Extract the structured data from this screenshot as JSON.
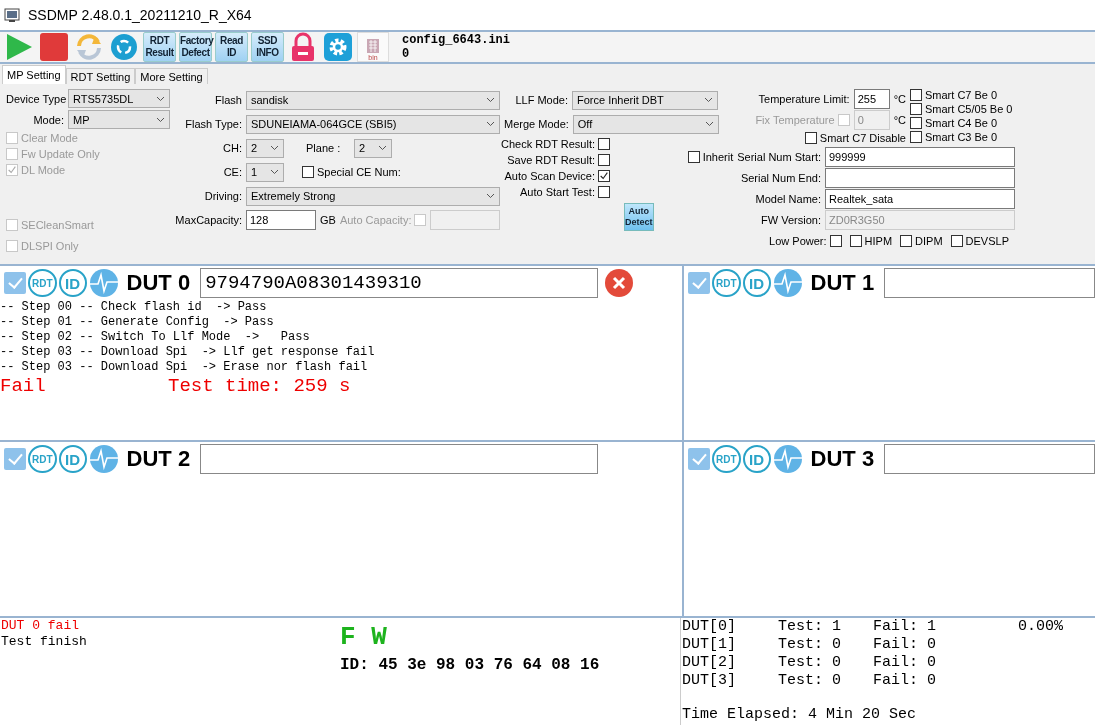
{
  "window": {
    "title": "SSDMP 2.48.0.1_20211210_R_X64"
  },
  "toolbar": {
    "buttons": [
      {
        "kind": "play"
      },
      {
        "kind": "stop"
      },
      {
        "kind": "refresh"
      },
      {
        "kind": "recycle"
      },
      {
        "kind": "text",
        "label": "RDT Result"
      },
      {
        "kind": "text",
        "label": "Factory Defect"
      },
      {
        "kind": "text",
        "label": "Read ID"
      },
      {
        "kind": "text",
        "label": "SSD INFO"
      },
      {
        "kind": "lock"
      },
      {
        "kind": "gear"
      },
      {
        "kind": "bin",
        "label": "bin"
      }
    ],
    "config_file": "config_6643.ini",
    "config_value": "0"
  },
  "tabs": [
    {
      "label": "MP Setting",
      "selected": true
    },
    {
      "label": "RDT Setting",
      "selected": false
    },
    {
      "label": "More Setting",
      "selected": false
    }
  ],
  "settings": {
    "col1": [
      [
        {
          "kind": "label",
          "text": "Device Type"
        },
        {
          "kind": "combo",
          "value": "RTS5735DL"
        }
      ],
      [
        {
          "kind": "label",
          "text": "Mode:"
        },
        {
          "kind": "combo",
          "value": "MP"
        }
      ],
      [
        {
          "kind": "check",
          "text": "Clear Mode",
          "checked": false,
          "disabled": true
        }
      ],
      [
        {
          "kind": "check",
          "text": "Fw Update Only",
          "checked": false,
          "disabled": true
        }
      ],
      [
        {
          "kind": "check",
          "text": "DL Mode",
          "checked": true,
          "disabled": true
        }
      ]
    ],
    "col1_bottom": [
      [
        {
          "kind": "check",
          "text": "SECleanSmart",
          "checked": false,
          "disabled": true
        }
      ],
      [
        {
          "kind": "check",
          "text": "DLSPI Only",
          "checked": false,
          "disabled": true
        }
      ]
    ],
    "col2": [
      [
        {
          "kind": "label",
          "text": "Flash"
        },
        {
          "kind": "combo",
          "value": "sandisk"
        }
      ],
      [
        {
          "kind": "label",
          "text": "Flash Type:"
        },
        {
          "kind": "combo",
          "value": "SDUNEIAMA-064GCE (SBI5)"
        }
      ],
      [
        {
          "kind": "label",
          "text": "CH:"
        },
        {
          "kind": "combo",
          "value": "2"
        },
        {
          "kind": "label",
          "text": "Plane :"
        },
        {
          "kind": "combo",
          "value": "2"
        }
      ],
      [
        {
          "kind": "label",
          "text": "CE:"
        },
        {
          "kind": "combo",
          "value": "1"
        },
        {
          "kind": "check",
          "text": "Special CE Num:",
          "checked": false,
          "disabled": false
        }
      ],
      [
        {
          "kind": "label",
          "text": "Driving:"
        },
        {
          "kind": "combo",
          "value": "Extremely Strong"
        }
      ],
      [
        {
          "kind": "label",
          "text": "MaxCapacity:"
        },
        {
          "kind": "field",
          "value": "128",
          "disabled": false
        },
        {
          "kind": "unit",
          "text": "GB"
        },
        {
          "kind": "labeled-check",
          "text": "Auto Capacity:",
          "checked": false,
          "disabled": true
        },
        {
          "kind": "field",
          "disabled": true
        }
      ]
    ],
    "col3": [
      [
        {
          "kind": "label",
          "text": "LLF Mode:"
        },
        {
          "kind": "combo",
          "value": "Force Inherit DBT"
        }
      ],
      [
        {
          "kind": "label",
          "text": "Merge Mode:"
        },
        {
          "kind": "combo",
          "value": "Off"
        }
      ],
      [
        {
          "kind": "labeled-check",
          "text": "Check RDT Result:",
          "checked": false,
          "disabled": false
        }
      ],
      [
        {
          "kind": "labeled-check",
          "text": "Save RDT Result:",
          "checked": false,
          "disabled": false
        }
      ],
      [
        {
          "kind": "labeled-check",
          "text": "Auto Scan Device:",
          "checked": true,
          "disabled": false
        }
      ],
      [
        {
          "kind": "labeled-check",
          "text": "Auto Start Test:",
          "checked": false,
          "disabled": false
        }
      ],
      [
        {
          "kind": "button",
          "text": "Auto Detect"
        }
      ]
    ],
    "temperature": [
      [
        {
          "kind": "label",
          "text": "Temperature Limit:"
        },
        {
          "kind": "field",
          "value": "255",
          "disabled": false
        },
        {
          "kind": "unit",
          "text": "°C"
        }
      ],
      [
        {
          "kind": "labeled-check",
          "text": "Fix Temperature",
          "checked": false,
          "disabled": true
        },
        {
          "kind": "field",
          "value": "0",
          "disabled": true
        },
        {
          "kind": "unit",
          "text": "°C"
        }
      ],
      [
        {
          "kind": "check",
          "text": "Smart C7 Disable",
          "checked": false,
          "disabled": false
        }
      ]
    ],
    "smart": [
      [
        {
          "kind": "check",
          "text": "Smart C7 Be 0",
          "checked": false,
          "disabled": false
        }
      ],
      [
        {
          "kind": "check",
          "text": "Smart C5/05 Be 0",
          "checked": false,
          "disabled": false
        }
      ],
      [
        {
          "kind": "check",
          "text": "Smart C4 Be 0",
          "checked": false,
          "disabled": false
        }
      ],
      [
        {
          "kind": "check",
          "text": "Smart C3 Be 0",
          "checked": false,
          "disabled": false
        }
      ]
    ],
    "device_info": [
      [
        {
          "kind": "check",
          "text": "Inherit",
          "checked": false,
          "disabled": false
        },
        {
          "kind": "label",
          "text": "Serial Num Start:"
        },
        {
          "kind": "field",
          "value": "999999",
          "disabled": false
        }
      ],
      [
        {
          "kind": "label",
          "text": "Serial Num End:"
        },
        {
          "kind": "field",
          "disabled": false
        }
      ],
      [
        {
          "kind": "label",
          "text": "Model Name:"
        },
        {
          "kind": "field",
          "value": "Realtek_sata",
          "disabled": false
        }
      ],
      [
        {
          "kind": "label",
          "text": "FW Version:"
        },
        {
          "kind": "field",
          "value": "ZD0R3G50",
          "disabled": true
        }
      ],
      [
        {
          "kind": "labeled-check",
          "text": "Low Power:",
          "checked": false,
          "disabled": false
        },
        {
          "kind": "check",
          "text": "HIPM",
          "checked": false,
          "disabled": false
        },
        {
          "kind": "check",
          "text": "DIPM",
          "checked": false,
          "disabled": false
        },
        {
          "kind": "check",
          "text": "DEVSLP",
          "checked": false,
          "disabled": false
        }
      ]
    ]
  },
  "duts": [
    {
      "title": "DUT 0",
      "checked": true,
      "badges": [
        "RDT",
        "ID"
      ],
      "serial": "9794790A08301439310",
      "error": true,
      "log": [
        "-- Step 00 -- Check flash id  -> Pass",
        "-- Step 01 -- Generate Config  -> Pass",
        "-- Step 02 -- Switch To Llf Mode  ->   Pass",
        "-- Step 03 -- Download Spi  -> Llf get response fail",
        "-- Step 03 -- Download Spi  -> Erase nor flash fail"
      ],
      "result": {
        "status": "Fail",
        "time": "Test time: 259 s"
      }
    },
    {
      "title": "DUT 1",
      "checked": true,
      "badges": [
        "RDT",
        "ID"
      ],
      "error": false
    },
    {
      "title": "DUT 2",
      "checked": true,
      "badges": [
        "RDT",
        "ID"
      ],
      "error": false
    },
    {
      "title": "DUT 3",
      "checked": true,
      "badges": [
        "RDT",
        "ID"
      ],
      "error": false
    }
  ],
  "messages": [
    {
      "text": "DUT 0 fail",
      "kind": "error"
    },
    {
      "text": "Test finish",
      "kind": "info"
    }
  ],
  "firmware": {
    "mark": "F W",
    "id": "ID: 45 3e 98 03 76 64 08 16"
  },
  "stats": {
    "rows": [
      {
        "dut": "DUT[0]",
        "test": "Test: 1",
        "fail": "Fail: 1",
        "rate": "0.00%"
      },
      {
        "dut": "DUT[1]",
        "test": "Test: 0",
        "fail": "Fail: 0"
      },
      {
        "dut": "DUT[2]",
        "test": "Test: 0",
        "fail": "Fail: 0"
      },
      {
        "dut": "DUT[3]",
        "test": "Test: 0",
        "fail": "Fail: 0"
      }
    ],
    "elapsed": "Time Elapsed: 4 Min 20 Sec"
  }
}
